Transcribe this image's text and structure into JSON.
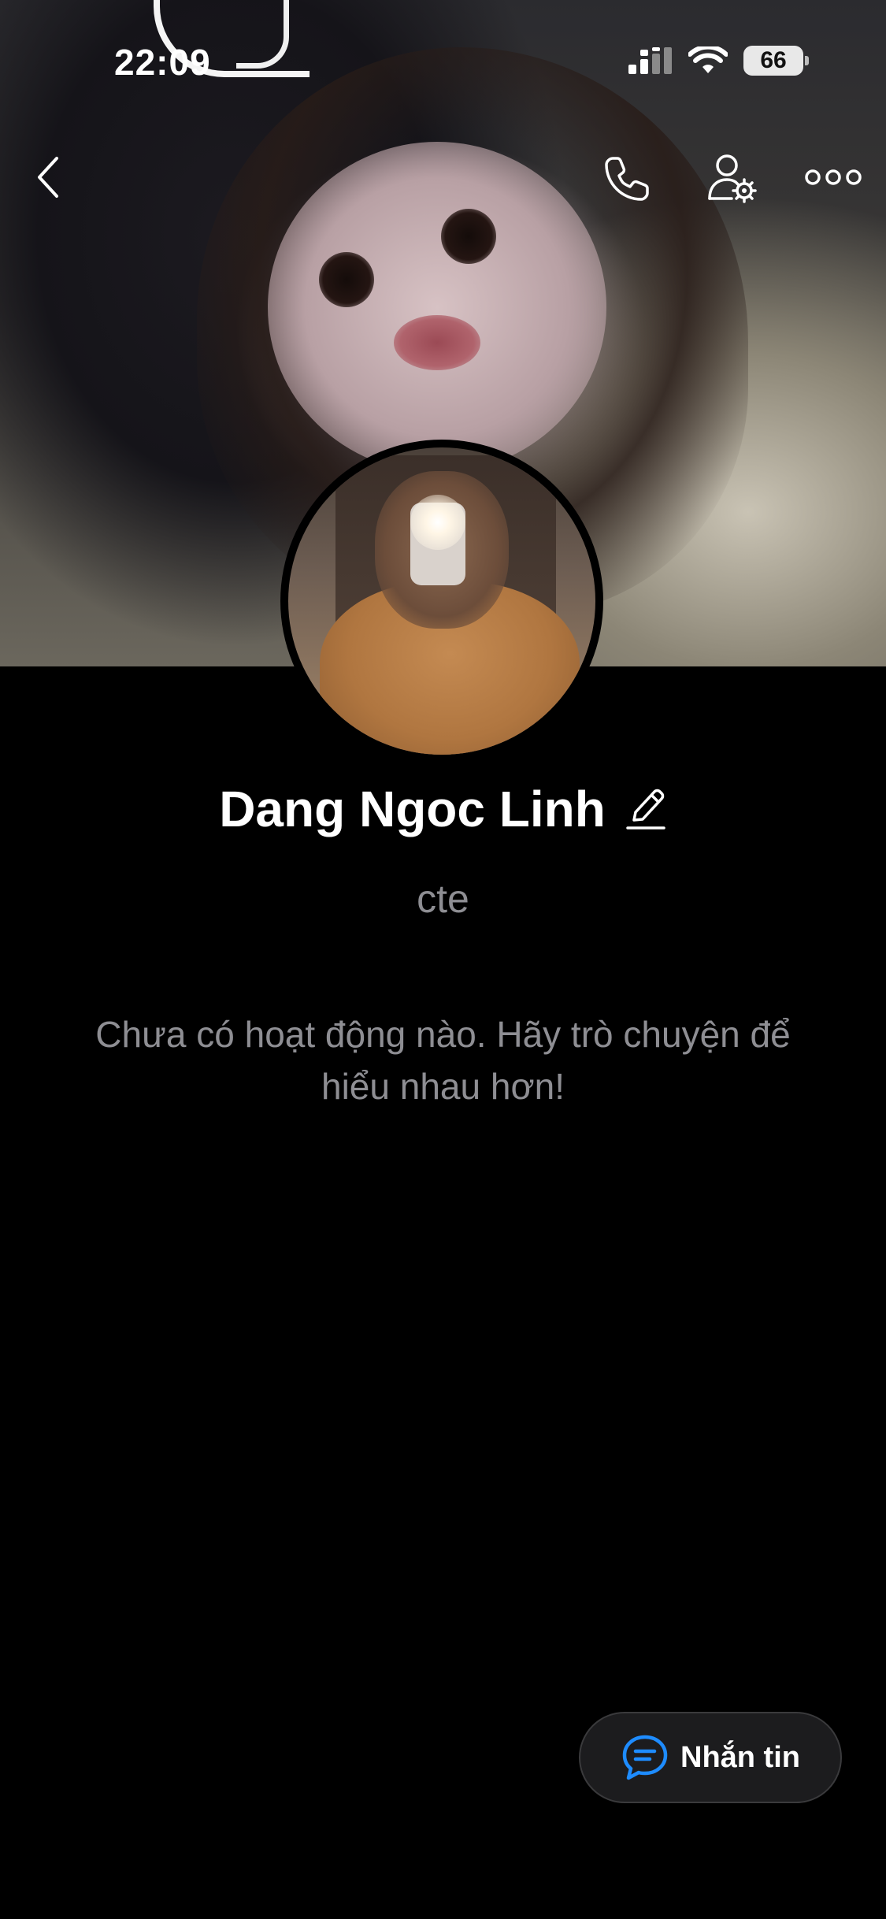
{
  "status_bar": {
    "time": "22:09",
    "battery": "66",
    "signal_icon": "cellular-signal-icon",
    "wifi_icon": "wifi-icon"
  },
  "nav": {
    "back_icon": "chevron-left-icon",
    "call_icon": "phone-icon",
    "settings_icon": "user-settings-icon",
    "more_icon": "more-horizontal-icon"
  },
  "profile": {
    "name": "Dang Ngoc Linh",
    "status": "cte",
    "empty_activity_message": "Chưa có hoạt động nào. Hãy trò chuyện để hiểu nhau hơn!"
  },
  "actions": {
    "message_label": "Nhắn tin",
    "message_icon": "chat-bubble-icon"
  },
  "colors": {
    "background": "#000000",
    "accent": "#1e8cff",
    "secondary_text": "#8e8e93",
    "button_bg": "#1c1c1e"
  }
}
